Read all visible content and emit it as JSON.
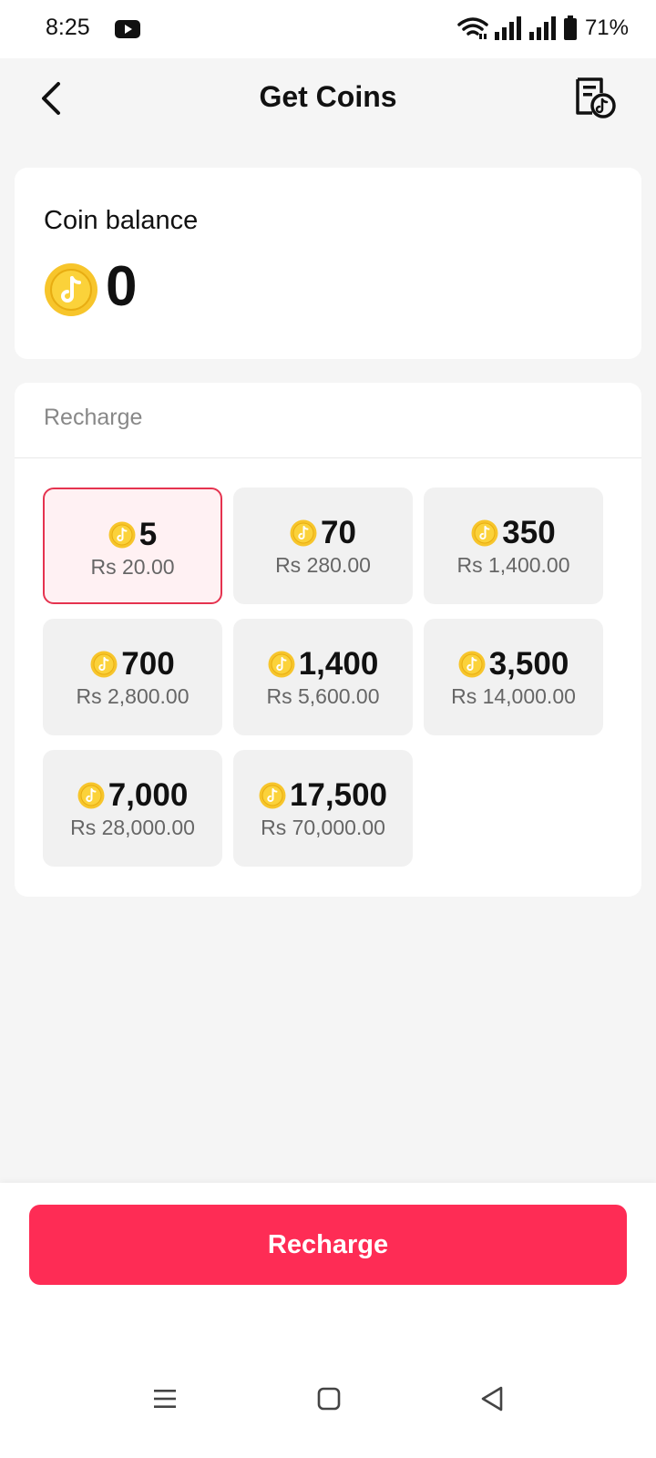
{
  "status_bar": {
    "time": "8:25",
    "battery": "71%"
  },
  "header": {
    "title": "Get Coins"
  },
  "balance": {
    "label": "Coin balance",
    "value": "0"
  },
  "recharge": {
    "label": "Recharge",
    "packages": [
      {
        "coins": "5",
        "price": "Rs 20.00",
        "selected": true
      },
      {
        "coins": "70",
        "price": "Rs 280.00"
      },
      {
        "coins": "350",
        "price": "Rs 1,400.00"
      },
      {
        "coins": "700",
        "price": "Rs 2,800.00"
      },
      {
        "coins": "1,400",
        "price": "Rs 5,600.00"
      },
      {
        "coins": "3,500",
        "price": "Rs 14,000.00"
      },
      {
        "coins": "7,000",
        "price": "Rs 28,000.00"
      },
      {
        "coins": "17,500",
        "price": "Rs 70,000.00"
      }
    ],
    "button_label": "Recharge"
  },
  "colors": {
    "accent": "#fe2c55",
    "selected_border": "#e5334f",
    "coin_gold": "#f7c52b"
  },
  "icons": [
    "youtube-icon",
    "wifi-icon",
    "signal-icon",
    "battery-icon",
    "back-arrow-icon",
    "transaction-history-icon",
    "coin-icon",
    "menu-icon",
    "home-icon",
    "back-triangle-icon"
  ]
}
